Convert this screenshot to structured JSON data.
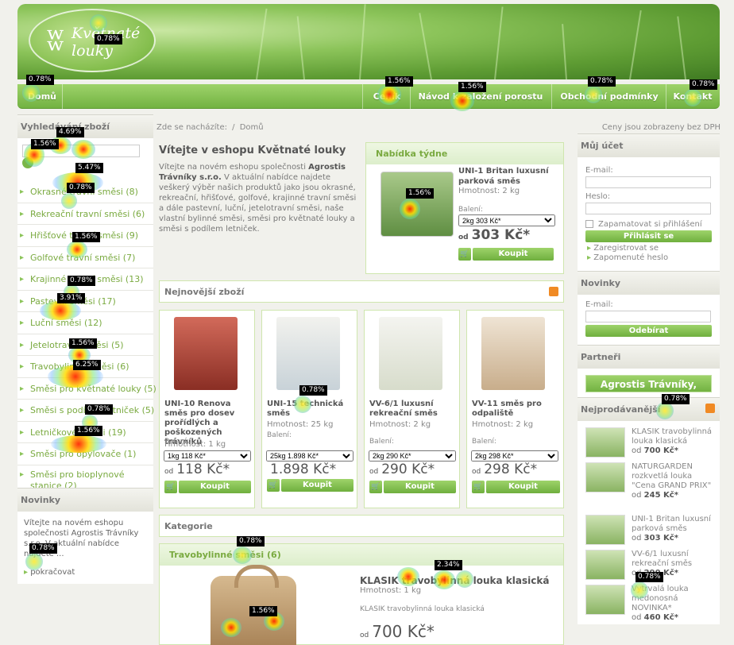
{
  "logo": {
    "line1": "Květnaté",
    "line2": "louky"
  },
  "nav": [
    "Domů",
    "Ceník",
    "Návod k založení porostu",
    "Obchodní podmínky",
    "Kontakt"
  ],
  "breadcrumb": {
    "prefix": "Zde se nacházíte:",
    "current": "Domů"
  },
  "prices_note": "Ceny jsou zobrazeny bez DPH",
  "search": {
    "title": "Vyhledávání zboží",
    "placeholder": ""
  },
  "categories": [
    "Okrasné trávní směsi (8)",
    "Rekreační travní směsi (6)",
    "Hřišťové travní směsi (9)",
    "Golfové travní směsi (7)",
    "Krajinné travní směsi (13)",
    "Pastevní směsi (17)",
    "Luční směsi (12)",
    "Jetelotravní směsi (5)",
    "Travobylinné směsi (6)",
    "Směsi pro květnaté louky (5)",
    "Směsi s podílem letniček (5)",
    "Letničkové směsi (19)",
    "Směsi pro opylovače (1)",
    "Směsi pro bioplynové stanice (2)"
  ],
  "left_news": {
    "title": "Novinky",
    "text": "Vítejte na novém eshopu společnosti Agrostis Trávníky s.r.o. V aktuální nabídce najdete ...",
    "more": "pokračovat"
  },
  "welcome": {
    "title": "Vítejte v eshopu Květnaté louky",
    "text_pre": "Vítejte na novém eshopu společnosti",
    "company": "Agrostis Trávníky s.r.o.",
    "text_post": "V aktuální nabídce najdete veškerý výběr našich produktů jako jsou okrasné, rekreační, hřišťové, golfové, krajinné travní směsi a dále pastevní, luční, jetelotravní směsi, naše vlastní bylinné směsi, směsi pro květnaté louky a směsi s podílem letniček."
  },
  "offer": {
    "title": "Nabídka týdne",
    "name": "UNI-1 Britan luxusní parková směs",
    "weight": "Hmotnost: 2 kg",
    "pack_label": "Balení:",
    "pack": "2kg 303 Kč*",
    "price_prefix": "od",
    "price": "303 Kč*",
    "buy": "Koupit"
  },
  "newest": {
    "title": "Nejnovější zboží",
    "items": [
      {
        "name": "UNI-10 Renova směs pro dosev prořídlých a poškozených trávníků",
        "weight": "Hmotnost: 1 kg",
        "pack_label": "Balení:",
        "pack": "1kg 118 Kč*",
        "price_prefix": "od",
        "price": "118 Kč*",
        "buy": "Koupit"
      },
      {
        "name": "UNI-15 technická směs",
        "weight": "Hmotnost: 25 kg",
        "pack_label": "Balení:",
        "pack": "25kg 1.898 Kč*",
        "price_prefix": "",
        "price": "1.898 Kč*",
        "buy": "Koupit"
      },
      {
        "name": "VV-6/1 luxusní rekreační směs",
        "weight": "Hmotnost: 2 kg",
        "pack_label": "Balení:",
        "pack": "2kg 290 Kč*",
        "price_prefix": "od",
        "price": "290 Kč*",
        "buy": "Koupit"
      },
      {
        "name": "VV-11 směs pro odpaliště",
        "weight": "Hmotnost: 2 kg",
        "pack_label": "Balení:",
        "pack": "2kg 298 Kč*",
        "price_prefix": "od",
        "price": "298 Kč*",
        "buy": "Koupit"
      }
    ]
  },
  "categories_section": {
    "title": "Kategorie",
    "sub_title": "Travobylinné směsi (6)",
    "product": "KLASIK travobylinná louka klasická",
    "weight": "Hmotnost: 1 kg",
    "desc": "KLASIK travobylinná louka klasická",
    "price_prefix": "od",
    "price": "700 Kč*"
  },
  "account": {
    "title": "Můj účet",
    "email_label": "E-mail:",
    "password_label": "Heslo:",
    "remember": "Zapamatovat si přihlášení",
    "login": "Přihlásit se",
    "register": "Zaregistrovat se",
    "forgot": "Zapomenuté heslo"
  },
  "right_news": {
    "title": "Novinky",
    "email_label": "E-mail:",
    "subscribe": "Odebírat"
  },
  "partners": {
    "title": "Partneři",
    "logo": "Agrostis Trávníky, s.r.o."
  },
  "bestsellers": {
    "title": "Nejprodávanější",
    "items": [
      {
        "name": "KLASIK travobylinná louka klasická",
        "price_prefix": "od",
        "price": "700 Kč*"
      },
      {
        "name": "NATURGARDEN rozkvetlá louka \"Cena GRAND PRIX\"",
        "price_prefix": "od",
        "price": "245 Kč*"
      },
      {
        "name": "UNI-1 Britan luxusní parková směs",
        "price_prefix": "od",
        "price": "303 Kč*"
      },
      {
        "name": "VV-6/1 luxusní rekreační směs",
        "price_prefix": "od",
        "price": "290 Kč*"
      },
      {
        "name": "Vytrvalá louka medonosná NOVINKA*",
        "price_prefix": "od",
        "price": "460 Kč*"
      }
    ]
  },
  "heatmap": {
    "labels": [
      "0.78%",
      "0.78%",
      "1.56%",
      "1.56%",
      "0.78%",
      "0.78%",
      "1.56%",
      "4.69%",
      "5.47%",
      "0.78%",
      "1.56%",
      "0.78%",
      "3.91%",
      "1.56%",
      "6.25%",
      "0.78%",
      "1.56%",
      "1.56%",
      "0.78%",
      "0.78%",
      "0.78%",
      "0.78%",
      "2.34%",
      "0.78%",
      "1.56%"
    ]
  }
}
